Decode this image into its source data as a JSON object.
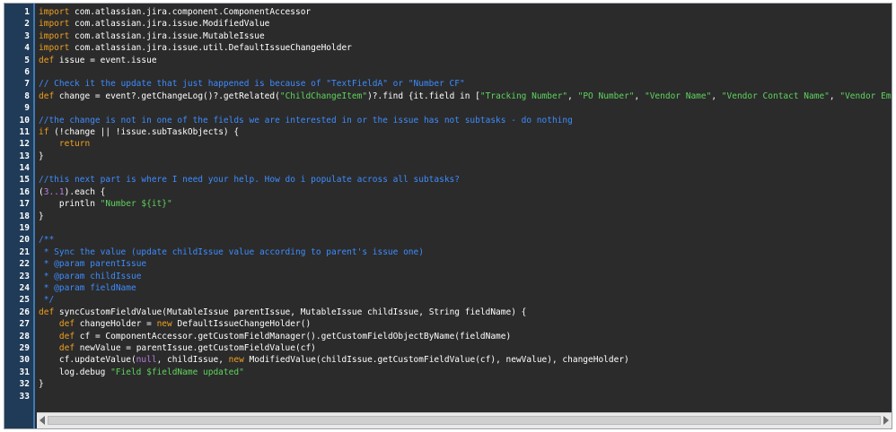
{
  "editor": {
    "line_numbers": [
      "1",
      "2",
      "3",
      "4",
      "5",
      "6",
      "7",
      "8",
      "9",
      "10",
      "11",
      "12",
      "13",
      "14",
      "15",
      "16",
      "17",
      "18",
      "19",
      "20",
      "21",
      "22",
      "23",
      "24",
      "25",
      "26",
      "27",
      "28",
      "29",
      "30",
      "31",
      "32",
      "33"
    ],
    "lines": [
      [
        [
          "keyword",
          "import"
        ],
        [
          "plain",
          " com.atlassian.jira.component.ComponentAccessor"
        ]
      ],
      [
        [
          "keyword",
          "import"
        ],
        [
          "plain",
          " com.atlassian.jira.issue.ModifiedValue"
        ]
      ],
      [
        [
          "keyword",
          "import"
        ],
        [
          "plain",
          " com.atlassian.jira.issue.MutableIssue"
        ]
      ],
      [
        [
          "keyword",
          "import"
        ],
        [
          "plain",
          " com.atlassian.jira.issue.util.DefaultIssueChangeHolder"
        ]
      ],
      [
        [
          "keyword",
          "def"
        ],
        [
          "plain",
          " issue = event.issue"
        ]
      ],
      [],
      [
        [
          "comment",
          "// Check it the update that just happened is because of \"TextFieldA\" or \"Number CF\""
        ]
      ],
      [
        [
          "keyword",
          "def"
        ],
        [
          "plain",
          " change = event?.getChangeLog()?.getRelated("
        ],
        [
          "string",
          "\"ChildChangeItem\""
        ],
        [
          "plain",
          ")?.find {it.field in ["
        ],
        [
          "string",
          "\"Tracking Number\""
        ],
        [
          "plain",
          ", "
        ],
        [
          "string",
          "\"PO Number\""
        ],
        [
          "plain",
          ", "
        ],
        [
          "string",
          "\"Vendor Name\""
        ],
        [
          "plain",
          ", "
        ],
        [
          "string",
          "\"Vendor Contact Name\""
        ],
        [
          "plain",
          ", "
        ],
        [
          "string",
          "\"Vendor Email\""
        ],
        [
          "plain",
          "]}"
        ]
      ],
      [],
      [
        [
          "comment",
          "//the change is not in one of the fields we are interested in or the issue has not subtasks - do nothing"
        ]
      ],
      [
        [
          "keyword",
          "if"
        ],
        [
          "plain",
          " (!change || !issue.subTaskObjects) {"
        ]
      ],
      [
        [
          "plain",
          "    "
        ],
        [
          "keyword",
          "return"
        ]
      ],
      [
        [
          "plain",
          "}"
        ]
      ],
      [],
      [
        [
          "comment",
          "//this next part is where I need your help. How do i populate across all subtasks?"
        ]
      ],
      [
        [
          "plain",
          "("
        ],
        [
          "number",
          "3..1"
        ],
        [
          "plain",
          ").each {"
        ]
      ],
      [
        [
          "plain",
          "    println "
        ],
        [
          "string",
          "\"Number ${it}\""
        ]
      ],
      [
        [
          "plain",
          "}"
        ]
      ],
      [],
      [
        [
          "comment",
          "/**"
        ]
      ],
      [
        [
          "comment",
          " * Sync the value (update childIssue value according to parent's issue one)"
        ]
      ],
      [
        [
          "comment",
          " * "
        ],
        [
          "annot",
          "@param"
        ],
        [
          "comment",
          " parentIssue"
        ]
      ],
      [
        [
          "comment",
          " * "
        ],
        [
          "annot",
          "@param"
        ],
        [
          "comment",
          " childIssue"
        ]
      ],
      [
        [
          "comment",
          " * "
        ],
        [
          "annot",
          "@param"
        ],
        [
          "comment",
          " fieldName"
        ]
      ],
      [
        [
          "comment",
          " */"
        ]
      ],
      [
        [
          "keyword",
          "def"
        ],
        [
          "plain",
          " syncCustomFieldValue(MutableIssue parentIssue, MutableIssue childIssue, String fieldName) {"
        ]
      ],
      [
        [
          "plain",
          "    "
        ],
        [
          "keyword",
          "def"
        ],
        [
          "plain",
          " changeHolder = "
        ],
        [
          "keyword",
          "new"
        ],
        [
          "plain",
          " DefaultIssueChangeHolder()"
        ]
      ],
      [
        [
          "plain",
          "    "
        ],
        [
          "keyword",
          "def"
        ],
        [
          "plain",
          " cf = ComponentAccessor.getCustomFieldManager().getCustomFieldObjectByName(fieldName)"
        ]
      ],
      [
        [
          "plain",
          "    "
        ],
        [
          "keyword",
          "def"
        ],
        [
          "plain",
          " newValue = parentIssue.getCustomFieldValue(cf)"
        ]
      ],
      [
        [
          "plain",
          "    cf.updateValue("
        ],
        [
          "null",
          "null"
        ],
        [
          "plain",
          ", childIssue, "
        ],
        [
          "keyword",
          "new"
        ],
        [
          "plain",
          " ModifiedValue(childIssue.getCustomFieldValue(cf), newValue), changeHolder)"
        ]
      ],
      [
        [
          "plain",
          "    log.debug "
        ],
        [
          "string",
          "\"Field $fieldName updated\""
        ]
      ],
      [
        [
          "plain",
          "}"
        ]
      ],
      []
    ]
  },
  "colors": {
    "background": "#2b2b2b",
    "gutter": "#1f3b57",
    "keyword": "#f0a020",
    "comment": "#3d8cff",
    "string": "#5ed35e",
    "number": "#b97fe0"
  }
}
